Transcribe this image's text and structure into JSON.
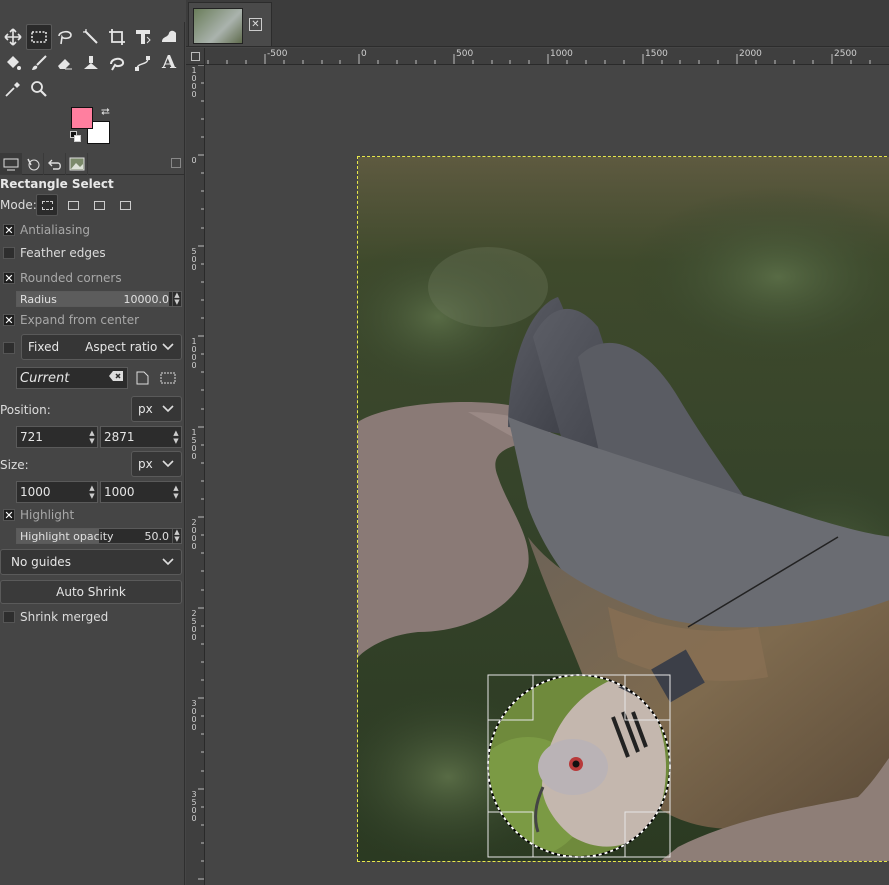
{
  "tools": {
    "row1": [
      "move-tool",
      "rect-select-tool",
      "free-select-tool",
      "fuzzy-select-tool",
      "crop-tool",
      "unified-transform-tool",
      "warp-transform-tool"
    ],
    "row2": [
      "bucket-fill-tool",
      "paintbrush-tool",
      "eraser-tool",
      "clone-tool",
      "smudge-tool",
      "paths-tool",
      "text-tool"
    ],
    "row3": [
      "color-picker-tool",
      "zoom-tool"
    ],
    "text_glyph": "A"
  },
  "colors": {
    "foreground": "#ff7f9f",
    "background": "#ffffff"
  },
  "tool_options": {
    "title": "Rectangle Select",
    "mode_label": "Mode:",
    "antialiasing": {
      "label": "Antialiasing",
      "checked": true
    },
    "feather_edges": {
      "label": "Feather edges",
      "checked": false
    },
    "rounded_corners": {
      "label": "Rounded corners",
      "checked": true
    },
    "radius": {
      "label": "Radius",
      "value": "10000.0"
    },
    "expand_from_center": {
      "label": "Expand from center",
      "checked": true
    },
    "fixed": {
      "label": "Fixed",
      "checked": false,
      "option": "Aspect ratio"
    },
    "preset": {
      "value": "Current"
    },
    "position": {
      "label": "Position:",
      "unit": "px",
      "x": "721",
      "y": "2871"
    },
    "size": {
      "label": "Size:",
      "unit": "px",
      "w": "1000",
      "h": "1000"
    },
    "highlight": {
      "label": "Highlight",
      "checked": true
    },
    "highlight_opacity": {
      "label": "Highlight opacity",
      "value": "50.0",
      "fraction": 0.5
    },
    "guides": {
      "value": "No guides"
    },
    "auto_shrink": {
      "label": "Auto Shrink"
    },
    "shrink_merged": {
      "label": "Shrink merged",
      "checked": false
    }
  },
  "rulers": {
    "horizontal": [
      "-500",
      "0",
      "500",
      "1000",
      "1500",
      "2000",
      "2500"
    ],
    "vertical": [
      "1000",
      "0",
      "500",
      "1000",
      "1500",
      "2000",
      "2500",
      "3000",
      "3500"
    ]
  },
  "checkmark": "✕",
  "arrows": {
    "up": "▲",
    "down": "▼",
    "swap": "⮂"
  },
  "tab": {
    "close_glyph": "✕"
  }
}
